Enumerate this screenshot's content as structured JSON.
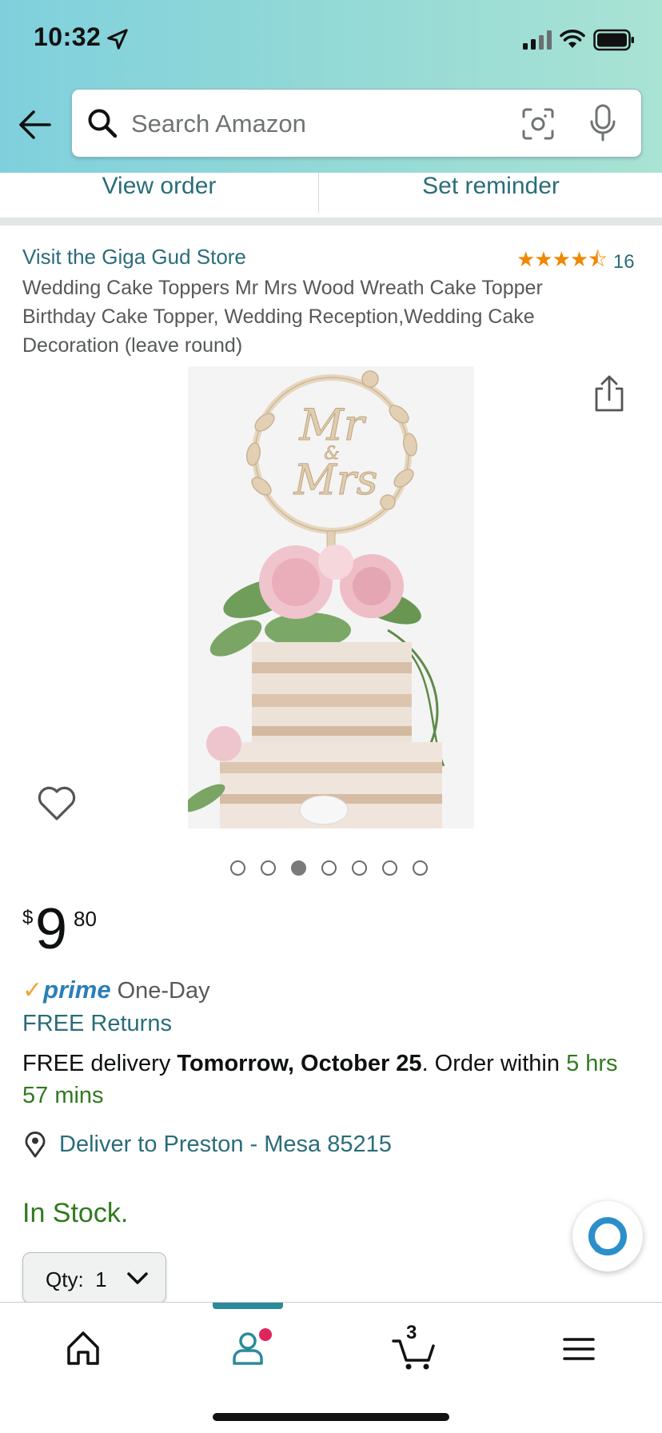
{
  "status_bar": {
    "time": "10:32"
  },
  "search": {
    "placeholder": "Search Amazon"
  },
  "order_strip": {
    "view_order": "View order",
    "set_reminder": "Set reminder"
  },
  "product": {
    "store_link": "Visit the Giga Gud Store",
    "rating_count": "16",
    "rating_stars": "★★★★⯪",
    "title": "Wedding Cake Toppers Mr Mrs Wood Wreath Cake Topper Birthday Cake Topper, Wedding Reception,Wedding Cake Decoration (leave round)",
    "image_count": 7,
    "active_image_index": 2
  },
  "price": {
    "symbol": "$",
    "whole": "9",
    "fraction": "80"
  },
  "prime": {
    "check": "✓",
    "word": "prime",
    "label": "One-Day"
  },
  "free_returns": "FREE Returns",
  "delivery": {
    "prefix": "FREE delivery ",
    "date": "Tomorrow, October 25",
    "middle": ". Order within ",
    "countdown": "5 hrs 57 mins"
  },
  "deliver_to": "Deliver to Preston - Mesa 85215",
  "stock": "In Stock.",
  "quantity": {
    "label": "Qty:",
    "value": "1"
  },
  "bottom_nav": {
    "cart_count": "3",
    "active": "account"
  },
  "colors": {
    "link_teal": "#2a6d7a",
    "success_green": "#2f7a1e",
    "star_orange": "#f08804",
    "prime_blue": "#2a7fb8",
    "header_gradient_start": "#7fd0dd",
    "header_gradient_end": "#a9e3d4"
  },
  "icons": [
    "location-arrow-icon",
    "signal-icon",
    "wifi-icon",
    "battery-icon",
    "back-arrow-icon",
    "search-icon",
    "camera-icon",
    "microphone-icon",
    "share-icon",
    "heart-icon",
    "location-pin-icon",
    "alexa-icon",
    "chevron-down-icon",
    "home-icon",
    "account-icon",
    "cart-icon",
    "menu-icon"
  ]
}
